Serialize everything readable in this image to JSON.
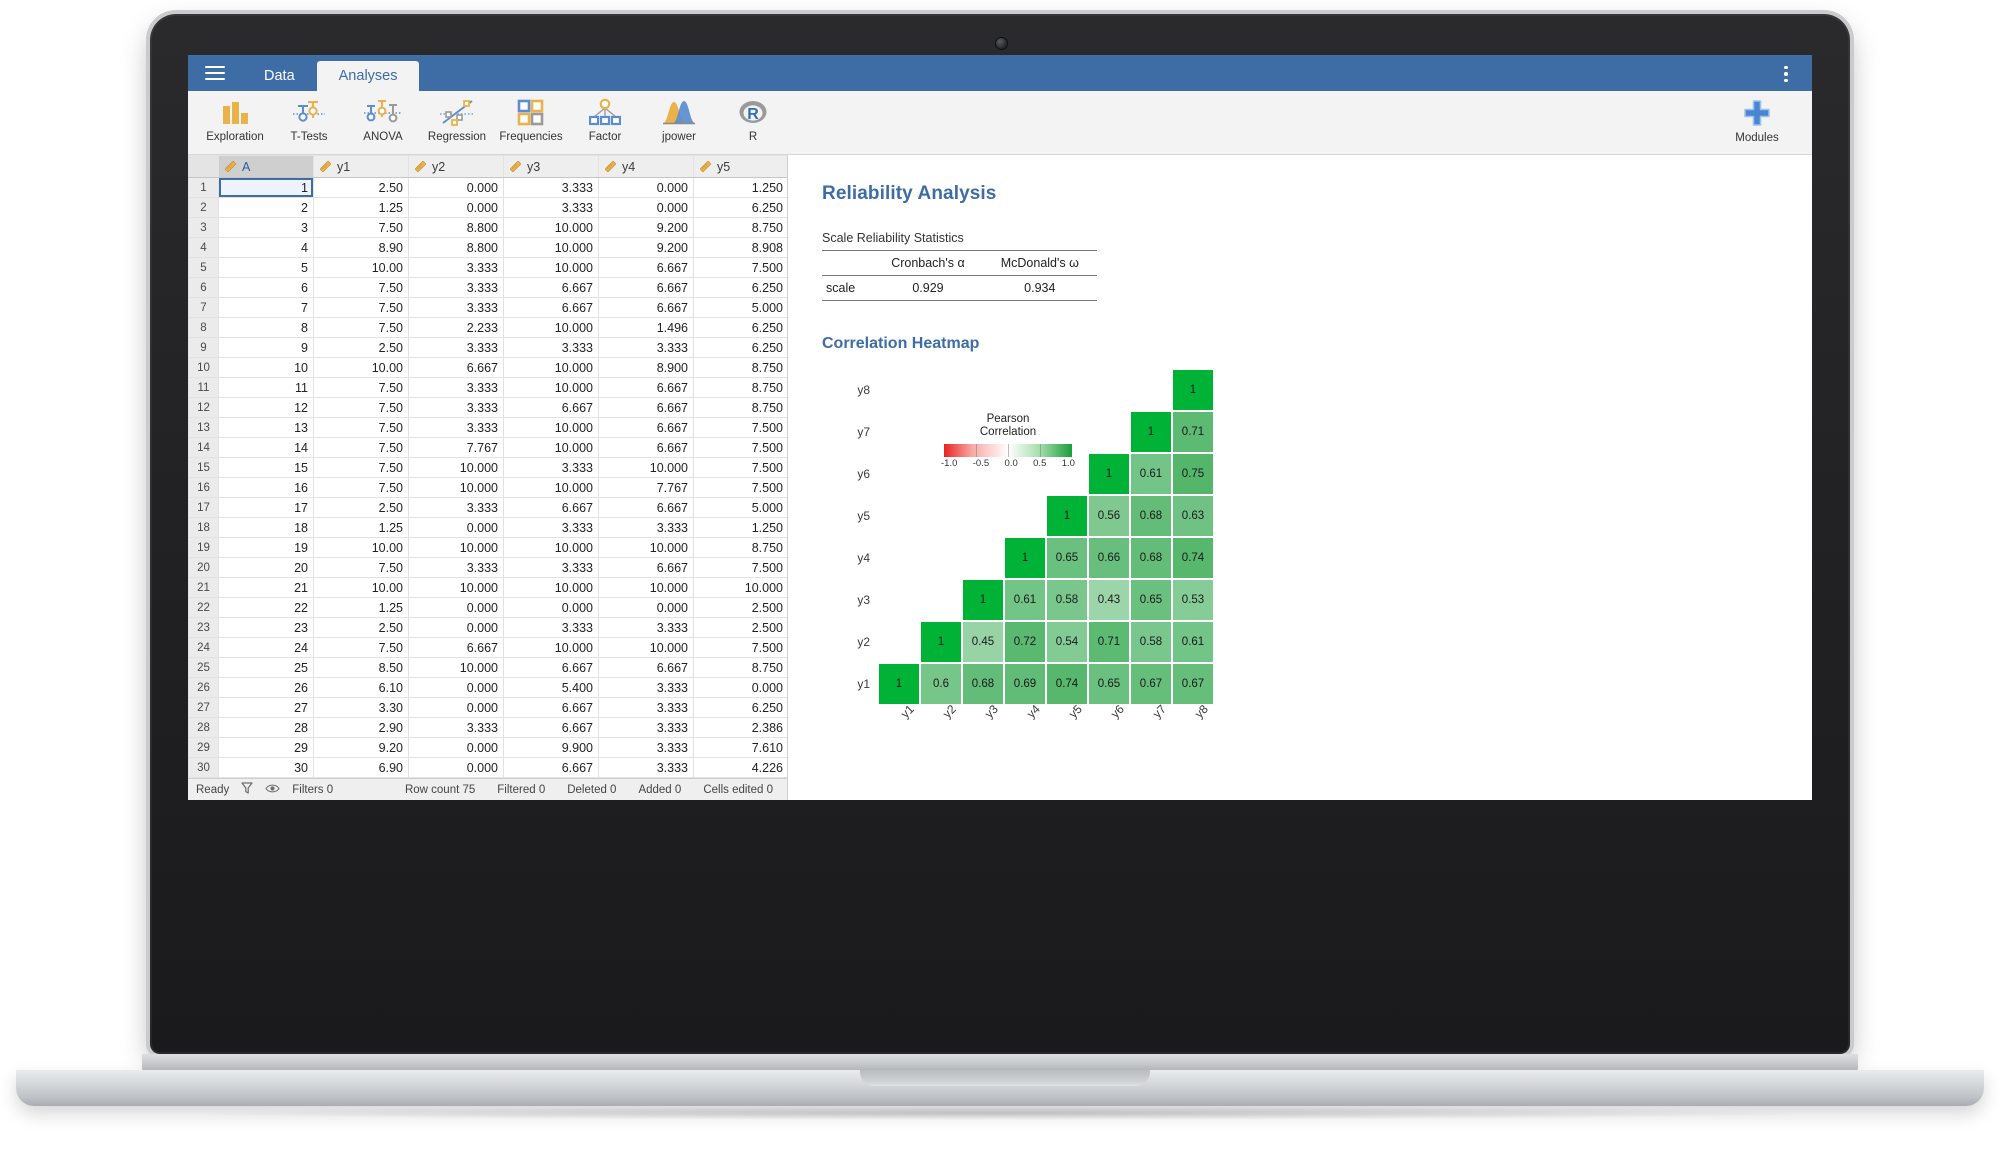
{
  "app": {
    "titlebar": {
      "menu_icon": "hamburger-icon",
      "kebab_icon": "more-vertical-icon",
      "tabs": [
        {
          "label": "Data",
          "active": false
        },
        {
          "label": "Analyses",
          "active": true
        }
      ]
    },
    "ribbon": {
      "items": [
        {
          "label": "Exploration",
          "icon": "bar-chart-icon"
        },
        {
          "label": "T-Tests",
          "icon": "ttest-icon"
        },
        {
          "label": "ANOVA",
          "icon": "anova-icon"
        },
        {
          "label": "Regression",
          "icon": "scatter-regression-icon"
        },
        {
          "label": "Frequencies",
          "icon": "frequencies-grid-icon"
        },
        {
          "label": "Factor",
          "icon": "factor-tree-icon"
        },
        {
          "label": "jpower",
          "icon": "power-curves-icon"
        },
        {
          "label": "R",
          "icon": "r-logo-icon"
        }
      ],
      "modules": {
        "label": "Modules",
        "icon": "plus-icon"
      }
    }
  },
  "spreadsheet": {
    "columns": [
      {
        "name": "A",
        "selected": true
      },
      {
        "name": "y1",
        "selected": false
      },
      {
        "name": "y2",
        "selected": false
      },
      {
        "name": "y3",
        "selected": false
      },
      {
        "name": "y4",
        "selected": false
      },
      {
        "name": "y5",
        "selected": false
      }
    ],
    "rows": [
      {
        "n": "1",
        "cells": [
          "1",
          "2.50",
          "0.000",
          "3.333",
          "0.000",
          "1.250"
        ]
      },
      {
        "n": "2",
        "cells": [
          "2",
          "1.25",
          "0.000",
          "3.333",
          "0.000",
          "6.250"
        ]
      },
      {
        "n": "3",
        "cells": [
          "3",
          "7.50",
          "8.800",
          "10.000",
          "9.200",
          "8.750"
        ]
      },
      {
        "n": "4",
        "cells": [
          "4",
          "8.90",
          "8.800",
          "10.000",
          "9.200",
          "8.908"
        ]
      },
      {
        "n": "5",
        "cells": [
          "5",
          "10.00",
          "3.333",
          "10.000",
          "6.667",
          "7.500"
        ]
      },
      {
        "n": "6",
        "cells": [
          "6",
          "7.50",
          "3.333",
          "6.667",
          "6.667",
          "6.250"
        ]
      },
      {
        "n": "7",
        "cells": [
          "7",
          "7.50",
          "3.333",
          "6.667",
          "6.667",
          "5.000"
        ]
      },
      {
        "n": "8",
        "cells": [
          "8",
          "7.50",
          "2.233",
          "10.000",
          "1.496",
          "6.250"
        ]
      },
      {
        "n": "9",
        "cells": [
          "9",
          "2.50",
          "3.333",
          "3.333",
          "3.333",
          "6.250"
        ]
      },
      {
        "n": "10",
        "cells": [
          "10",
          "10.00",
          "6.667",
          "10.000",
          "8.900",
          "8.750"
        ]
      },
      {
        "n": "11",
        "cells": [
          "11",
          "7.50",
          "3.333",
          "10.000",
          "6.667",
          "8.750"
        ]
      },
      {
        "n": "12",
        "cells": [
          "12",
          "7.50",
          "3.333",
          "6.667",
          "6.667",
          "8.750"
        ]
      },
      {
        "n": "13",
        "cells": [
          "13",
          "7.50",
          "3.333",
          "10.000",
          "6.667",
          "7.500"
        ]
      },
      {
        "n": "14",
        "cells": [
          "14",
          "7.50",
          "7.767",
          "10.000",
          "6.667",
          "7.500"
        ]
      },
      {
        "n": "15",
        "cells": [
          "15",
          "7.50",
          "10.000",
          "3.333",
          "10.000",
          "7.500"
        ]
      },
      {
        "n": "16",
        "cells": [
          "16",
          "7.50",
          "10.000",
          "10.000",
          "7.767",
          "7.500"
        ]
      },
      {
        "n": "17",
        "cells": [
          "17",
          "2.50",
          "3.333",
          "6.667",
          "6.667",
          "5.000"
        ]
      },
      {
        "n": "18",
        "cells": [
          "18",
          "1.25",
          "0.000",
          "3.333",
          "3.333",
          "1.250"
        ]
      },
      {
        "n": "19",
        "cells": [
          "19",
          "10.00",
          "10.000",
          "10.000",
          "10.000",
          "8.750"
        ]
      },
      {
        "n": "20",
        "cells": [
          "20",
          "7.50",
          "3.333",
          "3.333",
          "6.667",
          "7.500"
        ]
      },
      {
        "n": "21",
        "cells": [
          "21",
          "10.00",
          "10.000",
          "10.000",
          "10.000",
          "10.000"
        ]
      },
      {
        "n": "22",
        "cells": [
          "22",
          "1.25",
          "0.000",
          "0.000",
          "0.000",
          "2.500"
        ]
      },
      {
        "n": "23",
        "cells": [
          "23",
          "2.50",
          "0.000",
          "3.333",
          "3.333",
          "2.500"
        ]
      },
      {
        "n": "24",
        "cells": [
          "24",
          "7.50",
          "6.667",
          "10.000",
          "10.000",
          "7.500"
        ]
      },
      {
        "n": "25",
        "cells": [
          "25",
          "8.50",
          "10.000",
          "6.667",
          "6.667",
          "8.750"
        ]
      },
      {
        "n": "26",
        "cells": [
          "26",
          "6.10",
          "0.000",
          "5.400",
          "3.333",
          "0.000"
        ]
      },
      {
        "n": "27",
        "cells": [
          "27",
          "3.30",
          "0.000",
          "6.667",
          "3.333",
          "6.250"
        ]
      },
      {
        "n": "28",
        "cells": [
          "28",
          "2.90",
          "3.333",
          "6.667",
          "3.333",
          "2.386"
        ]
      },
      {
        "n": "29",
        "cells": [
          "29",
          "9.20",
          "0.000",
          "9.900",
          "3.333",
          "7.610"
        ]
      },
      {
        "n": "30",
        "cells": [
          "30",
          "6.90",
          "0.000",
          "6.667",
          "3.333",
          "4.226"
        ]
      }
    ],
    "statusbar": {
      "ready": "Ready",
      "filter_icon": "funnel-icon",
      "eye_icon": "eye-icon",
      "filters": "Filters 0",
      "row_count": "Row count 75",
      "filtered": "Filtered 0",
      "deleted": "Deleted 0",
      "added": "Added 0",
      "cells_edited": "Cells edited 0"
    }
  },
  "results": {
    "title": "Reliability Analysis",
    "scale_table": {
      "caption": "Scale Reliability Statistics",
      "headers": [
        "",
        "Cronbach's α",
        "McDonald's ω"
      ],
      "rows": [
        {
          "label": "scale",
          "values": [
            "0.929",
            "0.934"
          ]
        }
      ]
    },
    "heatmap_title": "Correlation Heatmap"
  },
  "chart_data": {
    "type": "heatmap",
    "title": "Correlation Heatmap",
    "legend_title": "Pearson Correlation",
    "legend_ticks": [
      "-1.0",
      "-0.5",
      "0.0",
      "0.5",
      "1.0"
    ],
    "zlim": [
      -1.0,
      1.0
    ],
    "colorscale": [
      "#e8241f",
      "#ffffff",
      "#1a9e3a"
    ],
    "legend_position": "inside-upper-left",
    "x": [
      "y1",
      "y2",
      "y3",
      "y4",
      "y5",
      "y6",
      "y7",
      "y8"
    ],
    "y": [
      "y1",
      "y2",
      "y3",
      "y4",
      "y5",
      "y6",
      "y7",
      "y8"
    ],
    "triangle": "lower-left-origin",
    "rows": [
      {
        "label": "y8",
        "values": [
          null,
          null,
          null,
          null,
          null,
          null,
          null,
          "1"
        ]
      },
      {
        "label": "y7",
        "values": [
          null,
          null,
          null,
          null,
          null,
          null,
          "1",
          "0.71"
        ]
      },
      {
        "label": "y6",
        "values": [
          null,
          null,
          null,
          null,
          null,
          "1",
          "0.61",
          "0.75"
        ]
      },
      {
        "label": "y5",
        "values": [
          null,
          null,
          null,
          null,
          "1",
          "0.56",
          "0.68",
          "0.63"
        ]
      },
      {
        "label": "y4",
        "values": [
          null,
          null,
          null,
          "1",
          "0.65",
          "0.66",
          "0.68",
          "0.74"
        ]
      },
      {
        "label": "y3",
        "values": [
          null,
          null,
          "1",
          "0.61",
          "0.58",
          "0.43",
          "0.65",
          "0.53"
        ]
      },
      {
        "label": "y2",
        "values": [
          null,
          "1",
          "0.45",
          "0.72",
          "0.54",
          "0.71",
          "0.58",
          "0.61"
        ]
      },
      {
        "label": "y1",
        "values": [
          "1",
          "0.6",
          "0.68",
          "0.69",
          "0.74",
          "0.65",
          "0.67",
          "0.67"
        ]
      }
    ]
  }
}
